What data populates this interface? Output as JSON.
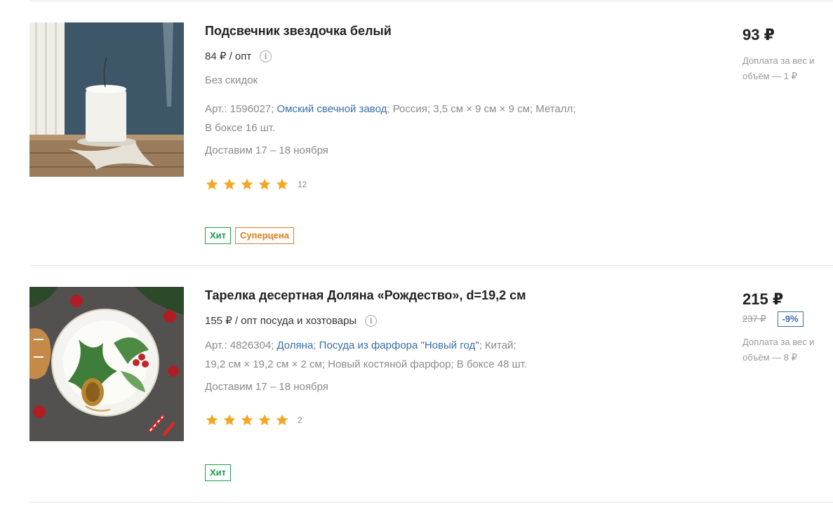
{
  "products": [
    {
      "title": "Подсвечник звездочка белый",
      "opt_price": "84 ₽ / опт",
      "no_discount": "Без скидок",
      "article_prefix": "Арт.: 1596027;",
      "manufacturer": "Омский свечной завод",
      "meta_line1_rest": "; Россия; 3,5 см × 9 см × 9 см; Металл;",
      "meta_line2": "В боксе 16 шт.",
      "delivery": "Доставим 17 – 18 ноября",
      "rating": 5,
      "rating_count": "12",
      "badges": [
        "Хит",
        "Суперцена"
      ],
      "price": "93 ₽",
      "surcharge": "Доплата за вес и объём — 1 ₽"
    },
    {
      "title": "Тарелка десертная Доляна «Рождество», d=19,2 см",
      "opt_price": "155 ₽ / опт посуда и хозтовары",
      "article_prefix": "Арт.: 4826304;",
      "brand": "Доляна",
      "collection": "Посуда из фарфора \"Новый год\"",
      "meta_line1_rest": "; Китай;",
      "meta_line2": "19,2 см × 19,2 см × 2 см; Новый костяной фарфор; В боксе 48 шт.",
      "delivery": "Доставим 17 – 18 ноября",
      "rating": 5,
      "rating_count": "2",
      "badges": [
        "Хит"
      ],
      "price": "215 ₽",
      "old_price": "237 ₽",
      "discount": "-9%",
      "surcharge": "Доплата за вес и объём — 8 ₽"
    }
  ],
  "colors": {
    "accent_green": "#1a9e4b",
    "accent_orange": "#e07b1a",
    "link_blue": "#3a6ea8",
    "star_yellow": "#f5a623"
  }
}
